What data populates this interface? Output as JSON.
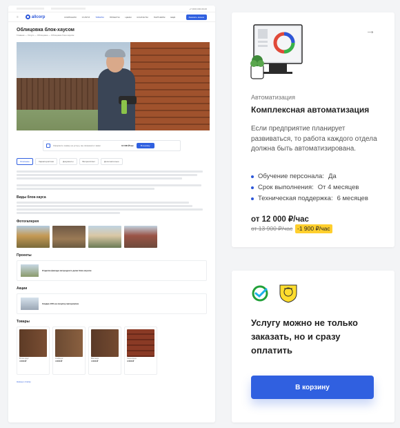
{
  "site": {
    "logo": "allcorp",
    "nav": [
      "КОМПАНИЯ",
      "УСЛУГИ",
      "ТОВАРЫ",
      "ПРОЕКТЫ",
      "ЦЕНЫ",
      "КОНТАКТЫ",
      "ПАРТНЁРЫ",
      "ЕЩЁ"
    ],
    "active_nav": 2,
    "phone": "+7 (000) 000-00-00",
    "order_button": "Заказать звонок"
  },
  "page": {
    "title": "Облицовка блок-хаусом",
    "breadcrumb": "Главная — Услуги — Облицовка — Облицовка блок-хаусом",
    "promo_text": "Оформите заявку на услугу, мы свяжемся с вами",
    "promo_price": "12 000 ₽/час",
    "promo_button": "В корзину",
    "tabs": [
      "Описание",
      "Характеристики",
      "Документы",
      "Вопрос/ответ",
      "Дополнительно"
    ],
    "section_types": "Виды блок-хауса",
    "section_photos": "Фотогалерея",
    "section_projects": "Проекты",
    "project_title": "Отделка фасада загородного дома блок-хаусом",
    "section_promos": "Акции",
    "promo_action": "Скидка 10% на покупку материалов",
    "section_goods": "Товары",
    "goods_prices": [
      "4 000 ₽",
      "4 000 ₽",
      "4 000 ₽",
      "4 000 ₽"
    ],
    "goods_names": [
      "Блок-хаус",
      "Сайдинг",
      "Вагонка",
      "Черепица"
    ],
    "footer_link": "Назад к списку"
  },
  "service": {
    "category": "Автоматизация",
    "title": "Комплексная автоматизация",
    "description": "Если предприятие планирует развиваться, то работа каждого отдела должна быть автоматизирована.",
    "features": [
      {
        "label": "Обучение персонала:",
        "value": "Да"
      },
      {
        "label": "Срок выполнения:",
        "value": "От 4 месяцев"
      },
      {
        "label": "Техническая поддержка:",
        "value": "6 месяцев"
      }
    ],
    "price": "от 12 000 ₽/час",
    "old_price": "от 13 900 ₽/час",
    "discount": "-1 900 ₽/час"
  },
  "payment": {
    "text": "Услугу можно не только заказать, но и сразу оплатить",
    "button": "В корзину"
  },
  "colors": {
    "accent": "#3060e0",
    "badge": "#ffcf2e",
    "sber": "#21a038",
    "tinkoff": "#ffdd2d"
  }
}
